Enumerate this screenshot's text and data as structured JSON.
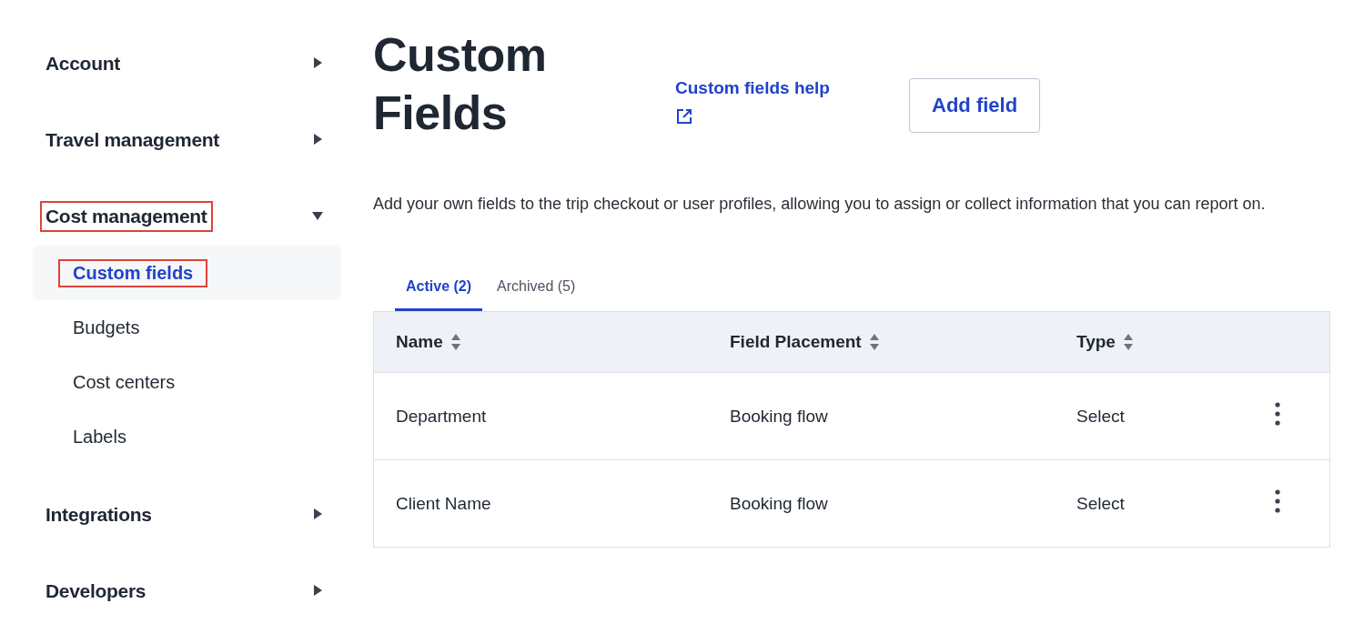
{
  "sidebar": {
    "sections": [
      {
        "label": "Account",
        "expanded": false,
        "highlighted": false
      },
      {
        "label": "Travel management",
        "expanded": false,
        "highlighted": false
      },
      {
        "label": "Cost management",
        "expanded": true,
        "highlighted": true,
        "children": [
          {
            "label": "Custom fields",
            "selected": true,
            "highlighted": true
          },
          {
            "label": "Budgets",
            "selected": false,
            "highlighted": false
          },
          {
            "label": "Cost centers",
            "selected": false,
            "highlighted": false
          },
          {
            "label": "Labels",
            "selected": false,
            "highlighted": false
          }
        ]
      },
      {
        "label": "Integrations",
        "expanded": false,
        "highlighted": false
      },
      {
        "label": "Developers",
        "expanded": false,
        "highlighted": false
      }
    ]
  },
  "page": {
    "title": "Custom Fields",
    "help_link": "Custom fields help",
    "add_button": "Add field",
    "description": "Add your own fields to the trip checkout or user profiles, allowing you to assign or collect information that you can report on."
  },
  "tabs": [
    {
      "label": "Active (2)",
      "selected": true
    },
    {
      "label": "Archived (5)",
      "selected": false
    }
  ],
  "table": {
    "columns": [
      "Name",
      "Field Placement",
      "Type"
    ],
    "rows": [
      [
        "Department",
        "Booking flow",
        "Select"
      ],
      [
        "Client Name",
        "Booking flow",
        "Select"
      ]
    ]
  }
}
